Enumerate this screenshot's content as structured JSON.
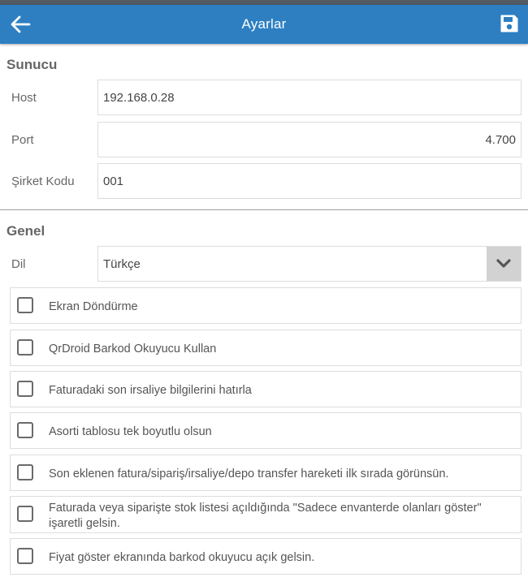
{
  "appbar": {
    "title": "Ayarlar",
    "back_icon": "arrow-left-icon",
    "save_icon": "floppy-disk-icon",
    "color": "#2d7fc2"
  },
  "server": {
    "section_title": "Sunucu",
    "host": {
      "label": "Host",
      "value": "192.168.0.28"
    },
    "port": {
      "label": "Port",
      "value": "4.700"
    },
    "company": {
      "label": "Şirket Kodu",
      "value": "001"
    }
  },
  "general": {
    "section_title": "Genel",
    "language": {
      "label": "Dil",
      "value": "Türkçe",
      "icon": "chevron-down-icon"
    },
    "options": [
      {
        "label": "Ekran Döndürme",
        "checked": false
      },
      {
        "label": "QrDroid Barkod Okuyucu Kullan",
        "checked": false
      },
      {
        "label": "Faturadaki son irsaliye bilgilerini hatırla",
        "checked": false
      },
      {
        "label": "Asorti tablosu tek boyutlu olsun",
        "checked": false
      },
      {
        "label": "Son eklenen fatura/sipariş/irsaliye/depo transfer hareketi ilk sırada görünsün.",
        "checked": false
      },
      {
        "label": "Faturada veya siparişte stok listesi açıldığında \"Sadece envanterde olanları göster\" işaretli gelsin.",
        "checked": false
      },
      {
        "label": "Fiyat göster ekranında barkod okuyucu açık gelsin.",
        "checked": false
      }
    ]
  }
}
